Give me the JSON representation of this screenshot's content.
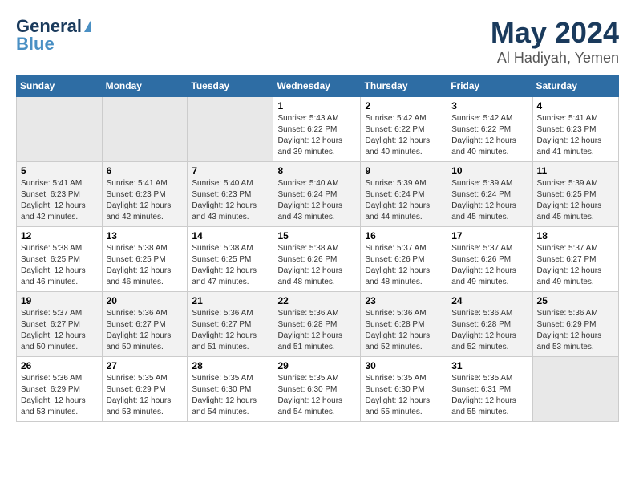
{
  "logo": {
    "line1": "General",
    "line2": "Blue"
  },
  "title": "May 2024",
  "subtitle": "Al Hadiyah, Yemen",
  "days_of_week": [
    "Sunday",
    "Monday",
    "Tuesday",
    "Wednesday",
    "Thursday",
    "Friday",
    "Saturday"
  ],
  "weeks": [
    [
      {
        "day": "",
        "info": ""
      },
      {
        "day": "",
        "info": ""
      },
      {
        "day": "",
        "info": ""
      },
      {
        "day": "1",
        "info": "Sunrise: 5:43 AM\nSunset: 6:22 PM\nDaylight: 12 hours and 39 minutes."
      },
      {
        "day": "2",
        "info": "Sunrise: 5:42 AM\nSunset: 6:22 PM\nDaylight: 12 hours and 40 minutes."
      },
      {
        "day": "3",
        "info": "Sunrise: 5:42 AM\nSunset: 6:22 PM\nDaylight: 12 hours and 40 minutes."
      },
      {
        "day": "4",
        "info": "Sunrise: 5:41 AM\nSunset: 6:23 PM\nDaylight: 12 hours and 41 minutes."
      }
    ],
    [
      {
        "day": "5",
        "info": "Sunrise: 5:41 AM\nSunset: 6:23 PM\nDaylight: 12 hours and 42 minutes."
      },
      {
        "day": "6",
        "info": "Sunrise: 5:41 AM\nSunset: 6:23 PM\nDaylight: 12 hours and 42 minutes."
      },
      {
        "day": "7",
        "info": "Sunrise: 5:40 AM\nSunset: 6:23 PM\nDaylight: 12 hours and 43 minutes."
      },
      {
        "day": "8",
        "info": "Sunrise: 5:40 AM\nSunset: 6:24 PM\nDaylight: 12 hours and 43 minutes."
      },
      {
        "day": "9",
        "info": "Sunrise: 5:39 AM\nSunset: 6:24 PM\nDaylight: 12 hours and 44 minutes."
      },
      {
        "day": "10",
        "info": "Sunrise: 5:39 AM\nSunset: 6:24 PM\nDaylight: 12 hours and 45 minutes."
      },
      {
        "day": "11",
        "info": "Sunrise: 5:39 AM\nSunset: 6:25 PM\nDaylight: 12 hours and 45 minutes."
      }
    ],
    [
      {
        "day": "12",
        "info": "Sunrise: 5:38 AM\nSunset: 6:25 PM\nDaylight: 12 hours and 46 minutes."
      },
      {
        "day": "13",
        "info": "Sunrise: 5:38 AM\nSunset: 6:25 PM\nDaylight: 12 hours and 46 minutes."
      },
      {
        "day": "14",
        "info": "Sunrise: 5:38 AM\nSunset: 6:25 PM\nDaylight: 12 hours and 47 minutes."
      },
      {
        "day": "15",
        "info": "Sunrise: 5:38 AM\nSunset: 6:26 PM\nDaylight: 12 hours and 48 minutes."
      },
      {
        "day": "16",
        "info": "Sunrise: 5:37 AM\nSunset: 6:26 PM\nDaylight: 12 hours and 48 minutes."
      },
      {
        "day": "17",
        "info": "Sunrise: 5:37 AM\nSunset: 6:26 PM\nDaylight: 12 hours and 49 minutes."
      },
      {
        "day": "18",
        "info": "Sunrise: 5:37 AM\nSunset: 6:27 PM\nDaylight: 12 hours and 49 minutes."
      }
    ],
    [
      {
        "day": "19",
        "info": "Sunrise: 5:37 AM\nSunset: 6:27 PM\nDaylight: 12 hours and 50 minutes."
      },
      {
        "day": "20",
        "info": "Sunrise: 5:36 AM\nSunset: 6:27 PM\nDaylight: 12 hours and 50 minutes."
      },
      {
        "day": "21",
        "info": "Sunrise: 5:36 AM\nSunset: 6:27 PM\nDaylight: 12 hours and 51 minutes."
      },
      {
        "day": "22",
        "info": "Sunrise: 5:36 AM\nSunset: 6:28 PM\nDaylight: 12 hours and 51 minutes."
      },
      {
        "day": "23",
        "info": "Sunrise: 5:36 AM\nSunset: 6:28 PM\nDaylight: 12 hours and 52 minutes."
      },
      {
        "day": "24",
        "info": "Sunrise: 5:36 AM\nSunset: 6:28 PM\nDaylight: 12 hours and 52 minutes."
      },
      {
        "day": "25",
        "info": "Sunrise: 5:36 AM\nSunset: 6:29 PM\nDaylight: 12 hours and 53 minutes."
      }
    ],
    [
      {
        "day": "26",
        "info": "Sunrise: 5:36 AM\nSunset: 6:29 PM\nDaylight: 12 hours and 53 minutes."
      },
      {
        "day": "27",
        "info": "Sunrise: 5:35 AM\nSunset: 6:29 PM\nDaylight: 12 hours and 53 minutes."
      },
      {
        "day": "28",
        "info": "Sunrise: 5:35 AM\nSunset: 6:30 PM\nDaylight: 12 hours and 54 minutes."
      },
      {
        "day": "29",
        "info": "Sunrise: 5:35 AM\nSunset: 6:30 PM\nDaylight: 12 hours and 54 minutes."
      },
      {
        "day": "30",
        "info": "Sunrise: 5:35 AM\nSunset: 6:30 PM\nDaylight: 12 hours and 55 minutes."
      },
      {
        "day": "31",
        "info": "Sunrise: 5:35 AM\nSunset: 6:31 PM\nDaylight: 12 hours and 55 minutes."
      },
      {
        "day": "",
        "info": ""
      }
    ]
  ]
}
